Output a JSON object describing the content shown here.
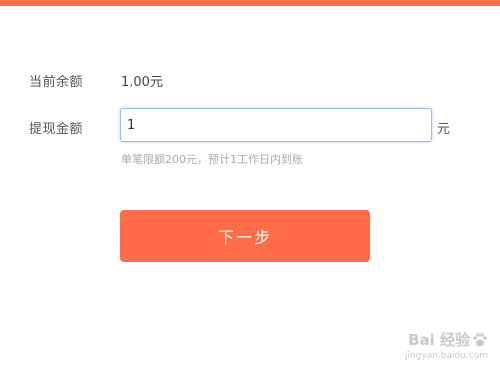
{
  "colors": {
    "accent": "#ff6c47",
    "input_border": "#8ec0ea",
    "label_text": "#555555",
    "hint_text": "#aaaaaa"
  },
  "form": {
    "balance_label": "当前余额",
    "balance_value": "1.00元",
    "withdraw_label": "提现金额",
    "withdraw_input_value": "1",
    "unit": "元",
    "hint": "单笔限额200元，预计1工作日内到账"
  },
  "actions": {
    "next_label": "下一步"
  },
  "watermark": {
    "brand": "Bai 经验",
    "url": "jingyan.baidu.com",
    "icon": "baidu-paw-icon"
  }
}
